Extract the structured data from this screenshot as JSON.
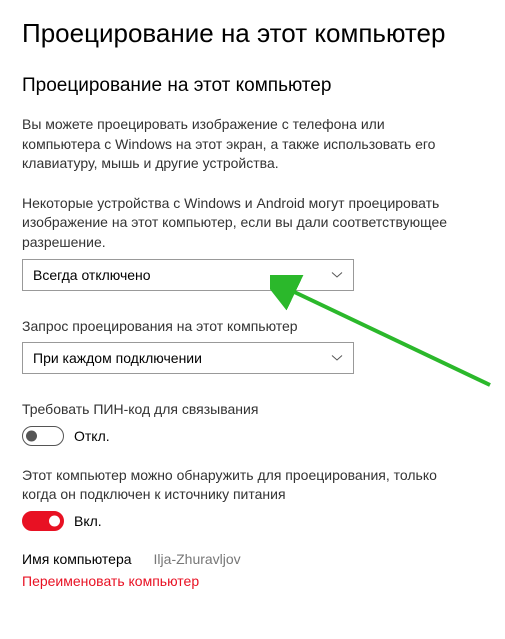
{
  "page_title": "Проецирование на этот компьютер",
  "section_title": "Проецирование на этот компьютер",
  "intro": "Вы можете проецировать изображение с телефона или компьютера с Windows на этот экран, а также использовать его клавиатуру, мышь и другие устройства.",
  "permission": {
    "label": "Некоторые устройства с Windows и Android могут проецировать изображение на этот компьютер, если вы дали соответствующее разрешение.",
    "value": "Всегда отключено"
  },
  "ask": {
    "label": "Запрос проецирования на этот компьютер",
    "value": "При каждом подключении"
  },
  "pin": {
    "label": "Требовать ПИН-код для связывания",
    "state_text": "Откл."
  },
  "discover": {
    "label": "Этот компьютер можно обнаружить для проецирования, только когда он подключен к источнику питания",
    "state_text": "Вкл."
  },
  "pc_name": {
    "label": "Имя компьютера",
    "value": "Ilja-Zhuravljov"
  },
  "rename_link": "Переименовать компьютер"
}
